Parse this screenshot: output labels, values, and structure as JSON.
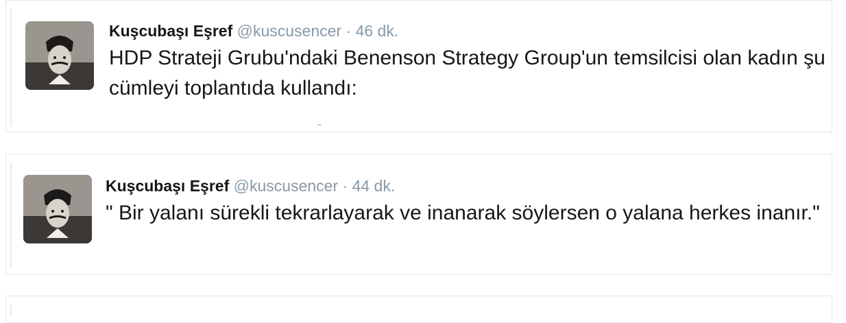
{
  "tweets": [
    {
      "name": "Kuşcubaşı Eşref",
      "handle": "@kuscusencer",
      "separator": "·",
      "time": "46 dk.",
      "text": "HDP Strateji Grubu'ndaki Benenson Strategy Group'un temsilcisi olan kadın şu cümleyi toplantıda kullandı:"
    },
    {
      "name": "Kuşcubaşı Eşref",
      "handle": "@kuscusencer",
      "separator": "·",
      "time": "44 dk.",
      "text": "\" Bir yalanı sürekli tekrarlayarak ve inanarak söylersen o yalana herkes inanır.\""
    }
  ],
  "colors": {
    "text": "#14171a",
    "muted": "#8899a6",
    "border": "#e1e8ed"
  }
}
